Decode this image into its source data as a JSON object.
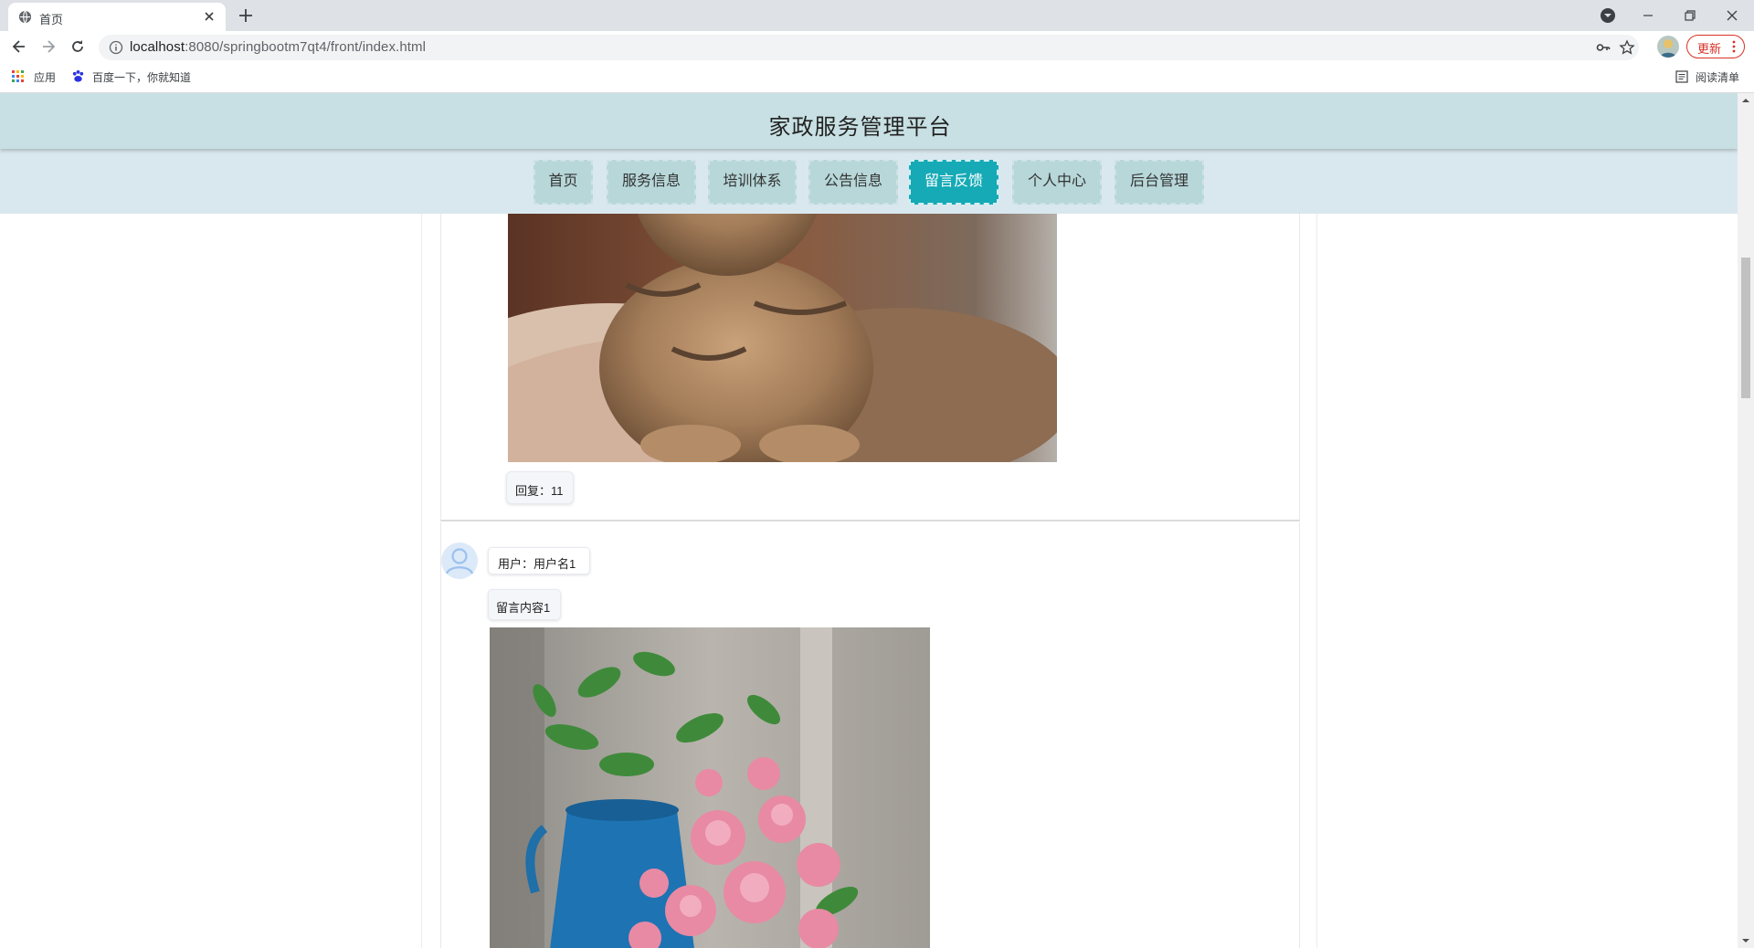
{
  "browser": {
    "tab_title": "首页",
    "url_host": "localhost",
    "url_rest": ":8080/springbootm7qt4/front/index.html",
    "update_label": "更新",
    "bookmarks": {
      "apps": "应用",
      "baidu": "百度一下，你就知道",
      "reading_list": "阅读清单"
    }
  },
  "site": {
    "title": "家政服务管理平台",
    "nav": [
      {
        "label": "首页",
        "active": false
      },
      {
        "label": "服务信息",
        "active": false
      },
      {
        "label": "培训体系",
        "active": false
      },
      {
        "label": "公告信息",
        "active": false
      },
      {
        "label": "留言反馈",
        "active": true
      },
      {
        "label": "个人中心",
        "active": false
      },
      {
        "label": "后台管理",
        "active": false
      }
    ]
  },
  "messages": [
    {
      "reply": "回复：11",
      "image": "tabby-cat-photo"
    },
    {
      "user": "用户：用户名1",
      "content": "留言内容1",
      "image": "pink-flowers-blue-pitcher-photo"
    }
  ],
  "colors": {
    "header_bg": "#c8e0e3",
    "nav_bg": "#d9e8ef",
    "nav_item": "#b7d7d9",
    "nav_active": "#15aab6"
  },
  "icons": [
    "globe-icon",
    "close-icon",
    "plus-icon",
    "back-icon",
    "forward-icon",
    "reload-icon",
    "info-icon",
    "key-icon",
    "star-icon",
    "apps-grid-icon",
    "baidu-paw-icon",
    "reading-list-icon",
    "user-avatar-icon"
  ]
}
